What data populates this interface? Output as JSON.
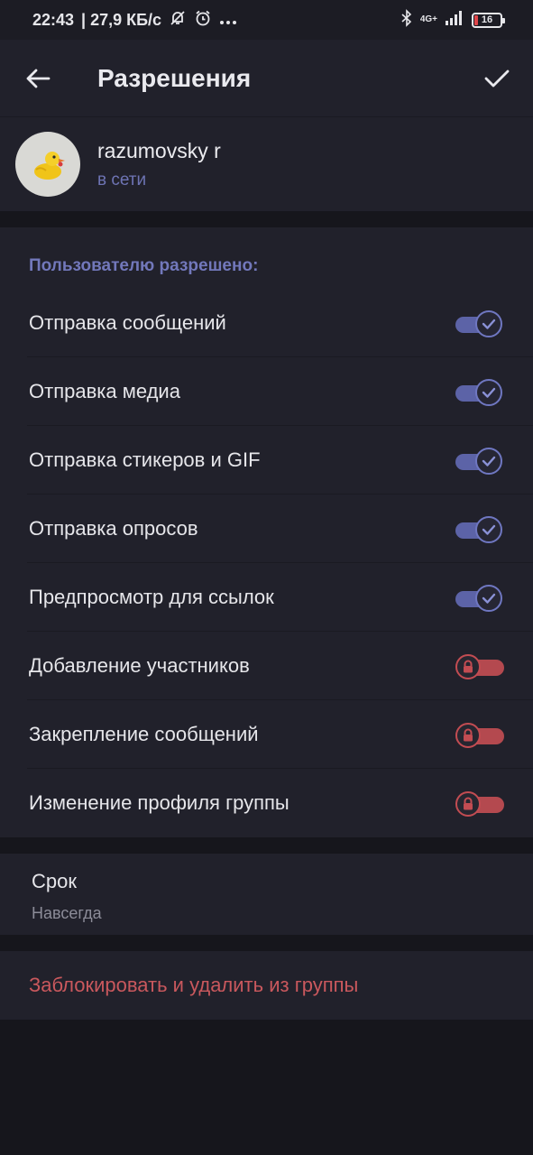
{
  "status_bar": {
    "time": "22:43",
    "net_speed": "| 27,9 КБ/с",
    "network": "4G+",
    "battery": "16",
    "icons": [
      "notifications-off-icon",
      "alarm-icon",
      "more-dots-icon",
      "bluetooth-icon",
      "signal-icon",
      "battery-icon"
    ]
  },
  "app_bar": {
    "title": "Разрешения",
    "icons": [
      "back-arrow-icon",
      "checkmark-icon"
    ]
  },
  "profile": {
    "name": "razumovsky r",
    "status": "в сети",
    "avatar": "duck-avatar"
  },
  "permissions": {
    "header": "Пользователю разрешено:",
    "items": [
      {
        "label": "Отправка сообщений",
        "state": "on"
      },
      {
        "label": "Отправка медиа",
        "state": "on"
      },
      {
        "label": "Отправка стикеров и GIF",
        "state": "on"
      },
      {
        "label": "Отправка опросов",
        "state": "on"
      },
      {
        "label": "Предпросмотр для ссылок",
        "state": "on"
      },
      {
        "label": "Добавление участников",
        "state": "locked"
      },
      {
        "label": "Закрепление сообщений",
        "state": "locked"
      },
      {
        "label": "Изменение профиля группы",
        "state": "locked"
      }
    ]
  },
  "term": {
    "title": "Срок",
    "value": "Навсегда"
  },
  "danger": {
    "label": "Заблокировать и удалить из группы"
  },
  "colors": {
    "accent": "#6f77c1",
    "accent_text": "#7278bb",
    "danger": "#c9585d",
    "locked": "#c24c52",
    "background": "#16161c",
    "surface": "#21212b"
  }
}
